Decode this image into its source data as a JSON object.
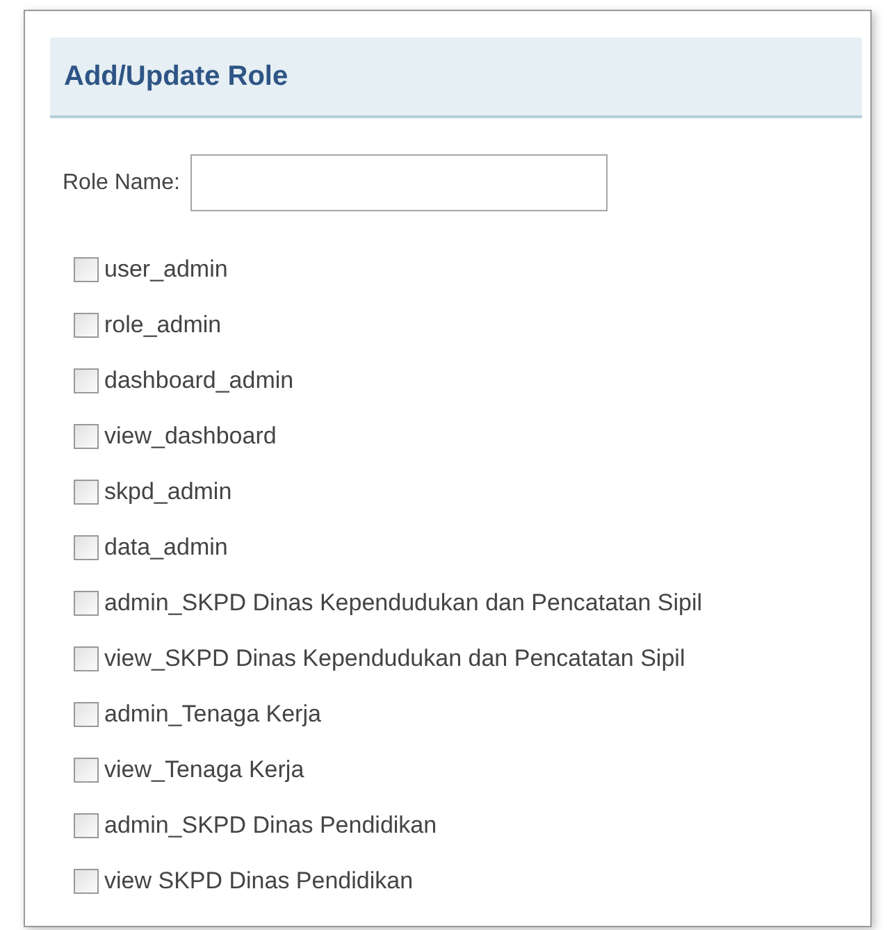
{
  "panel": {
    "title": "Add/Update Role"
  },
  "role_name": {
    "label": "Role Name:"
  },
  "roles": [
    {
      "label": "user_admin",
      "checked": false
    },
    {
      "label": "role_admin",
      "checked": false
    },
    {
      "label": "dashboard_admin",
      "checked": false
    },
    {
      "label": "view_dashboard",
      "checked": false
    },
    {
      "label": "skpd_admin",
      "checked": false
    },
    {
      "label": "data_admin",
      "checked": false
    },
    {
      "label": "admin_SKPD Dinas Kependudukan dan Pencatatan Sipil",
      "checked": false
    },
    {
      "label": "view_SKPD Dinas Kependudukan dan Pencatatan Sipil",
      "checked": false
    },
    {
      "label": "admin_Tenaga Kerja",
      "checked": false
    },
    {
      "label": "view_Tenaga Kerja",
      "checked": false
    },
    {
      "label": "admin_SKPD Dinas Pendidikan",
      "checked": false
    },
    {
      "label": "view SKPD Dinas Pendidikan",
      "checked": false
    }
  ]
}
